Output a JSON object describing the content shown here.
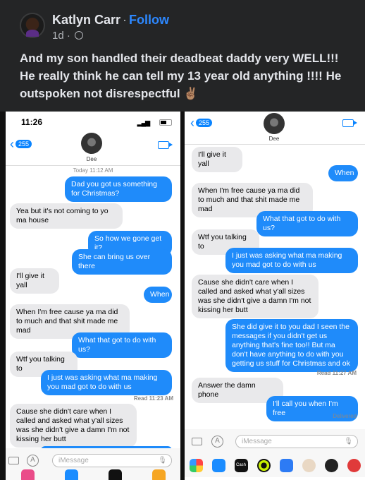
{
  "post": {
    "author": "Katlyn Carr",
    "separator": "·",
    "follow_label": "Follow",
    "age": "1d ·",
    "text": "And my son handled their deadbeat daddy very WELL!!! He really think he can tell my 13 year old anything !!!! He outspoken not disrespectful ✌🏽"
  },
  "left_screen": {
    "status_time": "11:26",
    "back_count": "255",
    "contact_name": "Dee",
    "timestamp_day": "Today",
    "timestamp_time": "11:12 AM",
    "messages": [
      {
        "side": "out",
        "text": "Dad you got us something for Christmas?"
      },
      {
        "side": "in",
        "text": "Yea but it's not coming to yo ma house"
      },
      {
        "side": "out",
        "text": "So how we gone get it?"
      },
      {
        "side": "out",
        "text": "She can bring us over there"
      },
      {
        "side": "in",
        "text": "I'll give it yall"
      },
      {
        "side": "out",
        "text": "When"
      },
      {
        "side": "in",
        "text": "When I'm free cause ya ma did to much and that shit made me mad"
      },
      {
        "side": "out",
        "text": "What that got to do with us?"
      },
      {
        "side": "in",
        "text": "Wtf you talking to"
      },
      {
        "side": "out",
        "text": "I just was asking what ma making you mad got to do with us"
      },
      {
        "side": "in",
        "text": "Cause she didn't care when I called and asked what y'all sizes was she didn't give a damn I'm not kissing her butt"
      }
    ],
    "read_receipt": "Read 11:23 AM",
    "input_placeholder": "iMessage"
  },
  "right_screen": {
    "back_count": "255",
    "contact_name": "Dee",
    "messages": [
      {
        "side": "in",
        "text": "I'll give it yall"
      },
      {
        "side": "out",
        "text": "When"
      },
      {
        "side": "in",
        "text": "When I'm free cause ya ma did to much and that shit made me mad"
      },
      {
        "side": "out",
        "text": "What that got to do with us?"
      },
      {
        "side": "in",
        "text": "Wtf you talking to"
      },
      {
        "side": "out",
        "text": "I just was asking what ma making you mad got to do with us"
      },
      {
        "side": "in",
        "text": "Cause she didn't care when I called and asked what y'all sizes was she didn't give a damn I'm not kissing her butt"
      },
      {
        "side": "out",
        "text": "She did give it to you dad I seen the messages if you didn't get us anything that's fine too!! But ma don't have anything to do with you getting us stuff for Christmas and ok"
      },
      {
        "side": "in",
        "text": "Answer the damn phone"
      },
      {
        "side": "out",
        "text": "I'll call you when I'm free"
      }
    ],
    "read_receipt": "Read 11:27 AM",
    "delivered": "Delivered",
    "input_placeholder": "iMessage",
    "cash_label": "Cash"
  }
}
